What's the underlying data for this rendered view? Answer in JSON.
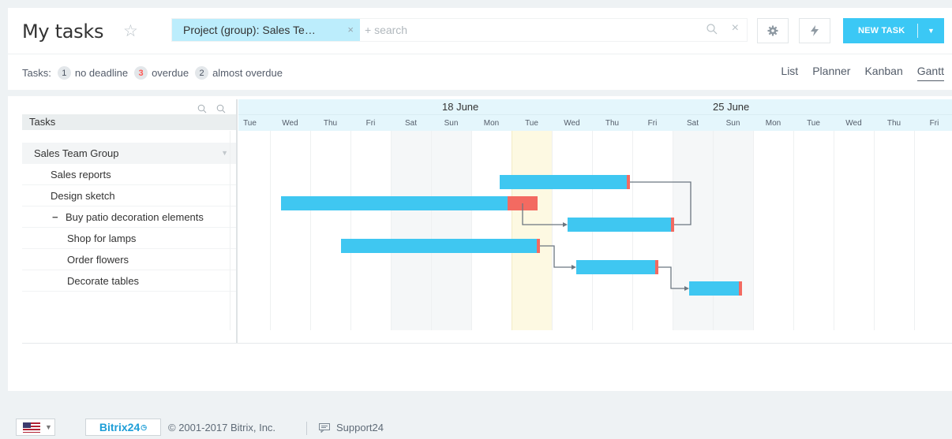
{
  "header": {
    "title": "My tasks",
    "filter_chip": "Project (group): Sales Te…",
    "search_placeholder": "+ search",
    "new_task_label": "NEW TASK"
  },
  "counters": {
    "prefix": "Tasks:",
    "items": [
      {
        "count": "1",
        "label": "no deadline"
      },
      {
        "count": "3",
        "label": "overdue"
      },
      {
        "count": "2",
        "label": "almost overdue"
      }
    ]
  },
  "views": [
    "List",
    "Planner",
    "Kanban",
    "Gantt"
  ],
  "active_view": "Gantt",
  "gantt": {
    "tree_header": "Tasks",
    "group": "Sales Team Group",
    "rows": [
      {
        "label": "Sales reports",
        "color": "#e3262d"
      },
      {
        "label": "Design sketch",
        "color": "#555555"
      },
      {
        "label": "Buy patio decoration elements",
        "color": "#222222"
      },
      {
        "label": "Shop for lamps",
        "color": "#e3262d"
      },
      {
        "label": "Order flowers",
        "color": "#222222"
      },
      {
        "label": "Decorate tables",
        "color": "#222222"
      }
    ],
    "weeks": [
      "18 June",
      "25 June"
    ],
    "days": [
      "Tue",
      "Wed",
      "Thu",
      "Fri",
      "Sat",
      "Sun",
      "Mon",
      "Tue",
      "Wed",
      "Thu",
      "Fri",
      "Sat",
      "Sun",
      "Mon",
      "Tue",
      "Wed",
      "Thu",
      "Fri"
    ]
  },
  "footer": {
    "logo_text": "Bitrix24",
    "copyright": "© 2001-2017 Bitrix, Inc.",
    "support": "Support24"
  },
  "colors": {
    "accent": "#3bc8f5",
    "bar": "#3fc7f1",
    "overdue": "#f36a61",
    "today": "#fdf9e2"
  }
}
